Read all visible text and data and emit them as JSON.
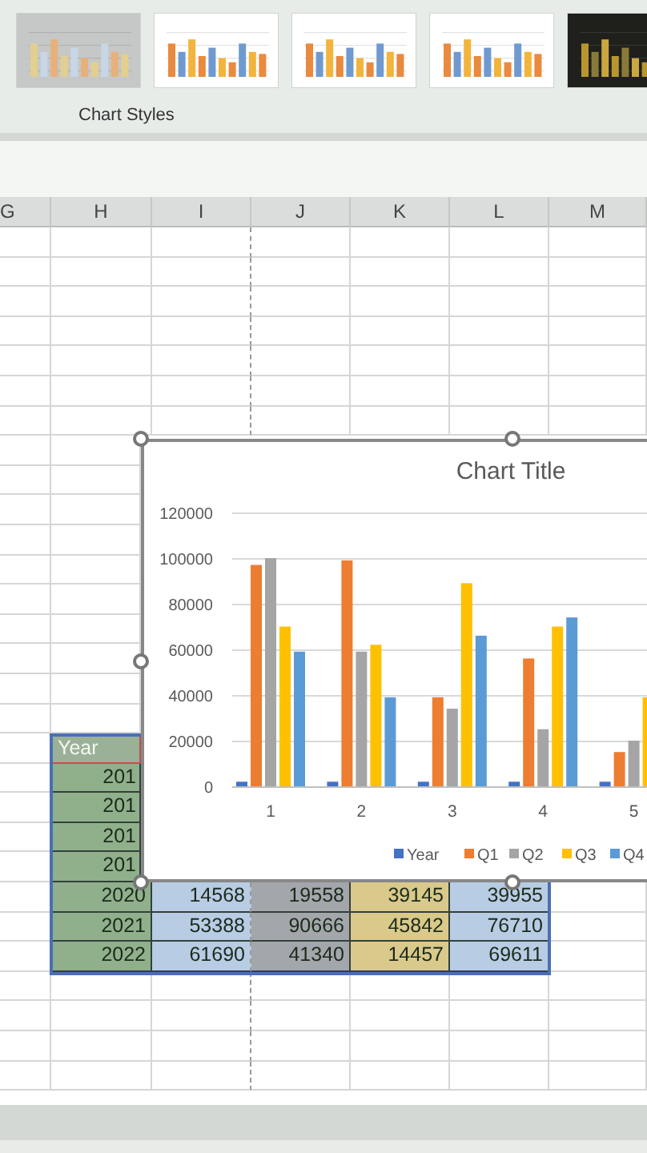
{
  "ribbon": {
    "style_thumbnails": [
      {
        "kind": "gray"
      },
      {
        "kind": "light"
      },
      {
        "kind": "light"
      },
      {
        "kind": "light"
      },
      {
        "kind": "dark"
      }
    ],
    "group_label": "Chart Styles"
  },
  "sheet": {
    "columns": [
      "G",
      "H",
      "I",
      "J",
      "K",
      "L",
      "M"
    ],
    "table": {
      "header": "Year",
      "rows": [
        [
          "201"
        ],
        [
          "201"
        ],
        [
          "201"
        ],
        [
          "201"
        ],
        [
          "2020",
          "14568",
          "19558",
          "39145",
          "39955"
        ],
        [
          "2021",
          "53388",
          "90666",
          "45842",
          "76710"
        ],
        [
          "2022",
          "61690",
          "41340",
          "14457",
          "69611"
        ]
      ]
    }
  },
  "chart": {
    "chart_data": {
      "type": "bar",
      "title": "Chart Title",
      "categories": [
        "1",
        "2",
        "3",
        "4",
        "5"
      ],
      "ylim": [
        0,
        120000
      ],
      "yticks": [
        0,
        20000,
        40000,
        60000,
        80000,
        100000,
        120000
      ],
      "legend": "bottom",
      "series": [
        {
          "name": "Year",
          "color": "#4472c4",
          "values": [
            2000,
            2000,
            2000,
            2000,
            2000
          ]
        },
        {
          "name": "Q1",
          "color": "#ed7d31",
          "values": [
            97000,
            99000,
            39000,
            56000,
            15000
          ]
        },
        {
          "name": "Q2",
          "color": "#a5a5a5",
          "values": [
            100000,
            59000,
            34000,
            25000,
            20000
          ]
        },
        {
          "name": "Q3",
          "color": "#ffc000",
          "values": [
            70000,
            62000,
            89000,
            70000,
            39000
          ]
        },
        {
          "name": "Q4",
          "color": "#5b9bd5",
          "values": [
            59000,
            39000,
            66000,
            74000,
            null
          ]
        }
      ]
    }
  }
}
